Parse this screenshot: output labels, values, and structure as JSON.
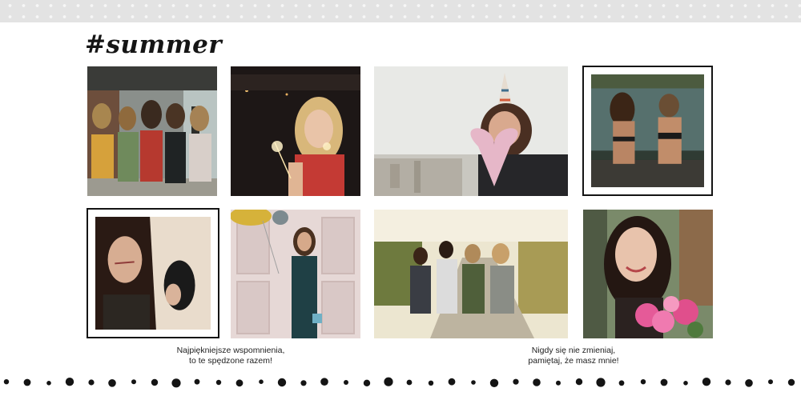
{
  "title": "#summer",
  "captions": {
    "left": {
      "line1": "Najpiękniejsze wspomnienia,",
      "line2": "to te spędzone razem!"
    },
    "right": {
      "line1": "Nigdy się nie zmieniaj,",
      "line2": "pamiętaj, że masz mnie!"
    }
  },
  "colors": {
    "banner": "#e3e3e3",
    "ink": "#141414",
    "background": "#ffffff"
  }
}
